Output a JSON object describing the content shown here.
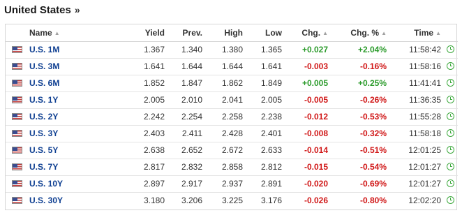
{
  "section": {
    "title": "United States",
    "chevron": "»"
  },
  "colors": {
    "positive": "#2b9b2b",
    "negative": "#d01616",
    "link": "#0d3e91",
    "clock": "#3faa3f"
  },
  "table": {
    "headers": {
      "name": "Name",
      "yield": "Yield",
      "prev": "Prev.",
      "high": "High",
      "low": "Low",
      "chg": "Chg.",
      "chg_pct": "Chg. %",
      "time": "Time"
    },
    "rows": [
      {
        "flag": "us-flag-icon",
        "name": "U.S. 1M",
        "yield": "1.367",
        "prev": "1.340",
        "high": "1.380",
        "low": "1.365",
        "chg": "+0.027",
        "chg_pct": "+2.04%",
        "time": "11:58:42",
        "dir": "pos"
      },
      {
        "flag": "us-flag-icon",
        "name": "U.S. 3M",
        "yield": "1.641",
        "prev": "1.644",
        "high": "1.644",
        "low": "1.641",
        "chg": "-0.003",
        "chg_pct": "-0.16%",
        "time": "11:58:16",
        "dir": "neg"
      },
      {
        "flag": "us-flag-icon",
        "name": "U.S. 6M",
        "yield": "1.852",
        "prev": "1.847",
        "high": "1.862",
        "low": "1.849",
        "chg": "+0.005",
        "chg_pct": "+0.25%",
        "time": "11:41:41",
        "dir": "pos"
      },
      {
        "flag": "us-flag-icon",
        "name": "U.S. 1Y",
        "yield": "2.005",
        "prev": "2.010",
        "high": "2.041",
        "low": "2.005",
        "chg": "-0.005",
        "chg_pct": "-0.26%",
        "time": "11:36:35",
        "dir": "neg"
      },
      {
        "flag": "us-flag-icon",
        "name": "U.S. 2Y",
        "yield": "2.242",
        "prev": "2.254",
        "high": "2.258",
        "low": "2.238",
        "chg": "-0.012",
        "chg_pct": "-0.53%",
        "time": "11:55:28",
        "dir": "neg"
      },
      {
        "flag": "us-flag-icon",
        "name": "U.S. 3Y",
        "yield": "2.403",
        "prev": "2.411",
        "high": "2.428",
        "low": "2.401",
        "chg": "-0.008",
        "chg_pct": "-0.32%",
        "time": "11:58:18",
        "dir": "neg"
      },
      {
        "flag": "us-flag-icon",
        "name": "U.S. 5Y",
        "yield": "2.638",
        "prev": "2.652",
        "high": "2.672",
        "low": "2.633",
        "chg": "-0.014",
        "chg_pct": "-0.51%",
        "time": "12:01:25",
        "dir": "neg"
      },
      {
        "flag": "us-flag-icon",
        "name": "U.S. 7Y",
        "yield": "2.817",
        "prev": "2.832",
        "high": "2.858",
        "low": "2.812",
        "chg": "-0.015",
        "chg_pct": "-0.54%",
        "time": "12:01:27",
        "dir": "neg"
      },
      {
        "flag": "us-flag-icon",
        "name": "U.S. 10Y",
        "yield": "2.897",
        "prev": "2.917",
        "high": "2.937",
        "low": "2.891",
        "chg": "-0.020",
        "chg_pct": "-0.69%",
        "time": "12:01:27",
        "dir": "neg"
      },
      {
        "flag": "us-flag-icon",
        "name": "U.S. 30Y",
        "yield": "3.180",
        "prev": "3.206",
        "high": "3.225",
        "low": "3.176",
        "chg": "-0.026",
        "chg_pct": "-0.80%",
        "time": "12:02:20",
        "dir": "neg"
      }
    ]
  }
}
